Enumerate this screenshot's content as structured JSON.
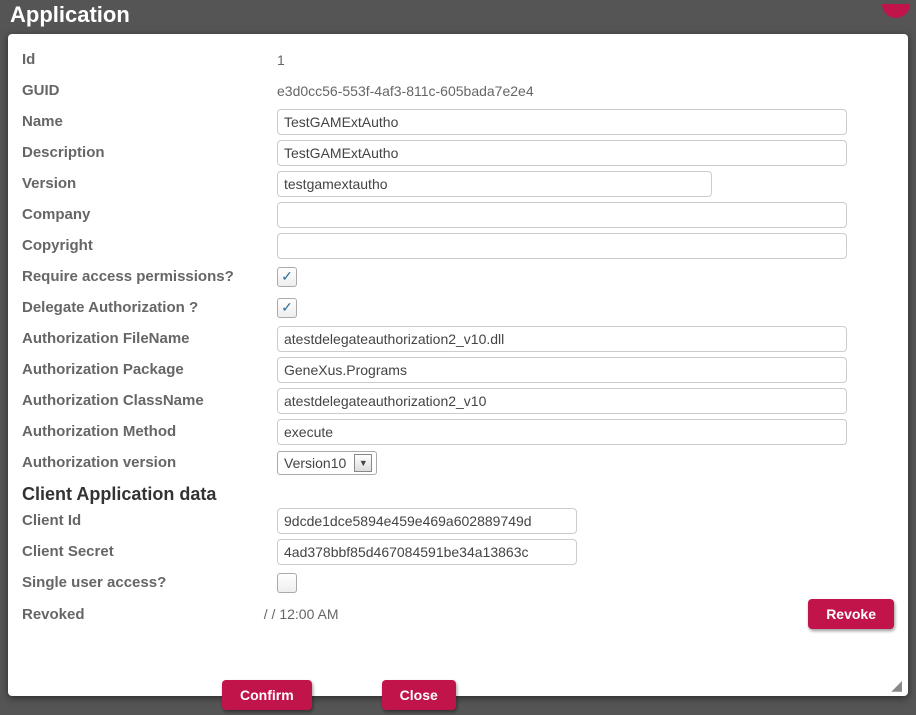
{
  "title": "Application",
  "labels": {
    "id": "Id",
    "guid": "GUID",
    "name": "Name",
    "description": "Description",
    "version": "Version",
    "company": "Company",
    "copyright": "Copyright",
    "requirePerm": "Require access permissions?",
    "delegateAuth": "Delegate Authorization ?",
    "authFile": "Authorization FileName",
    "authPkg": "Authorization Package",
    "authClass": "Authorization ClassName",
    "authMethod": "Authorization Method",
    "authVer": "Authorization version",
    "clientSection": "Client Application data",
    "clientId": "Client Id",
    "clientSecret": "Client Secret",
    "singleUser": "Single user access?",
    "revoked": "Revoked"
  },
  "values": {
    "id": "1",
    "guid": "e3d0cc56-553f-4af3-811c-605bada7e2e4",
    "name": "TestGAMExtAutho",
    "description": "TestGAMExtAutho",
    "version": "testgamextautho",
    "company": "",
    "copyright": "",
    "requirePerm": true,
    "delegateAuth": true,
    "authFile": "atestdelegateauthorization2_v10.dll",
    "authPkg": "GeneXus.Programs",
    "authClass": "atestdelegateauthorization2_v10",
    "authMethod": "execute",
    "authVer": "Version10",
    "clientId": "9dcde1dce5894e459e469a602889749d",
    "clientSecret": "4ad378bbf85d467084591be34a13863c",
    "singleUser": false,
    "revoked": "/ / 12:00 AM"
  },
  "buttons": {
    "revoke": "Revoke",
    "confirm": "Confirm",
    "close": "Close"
  }
}
